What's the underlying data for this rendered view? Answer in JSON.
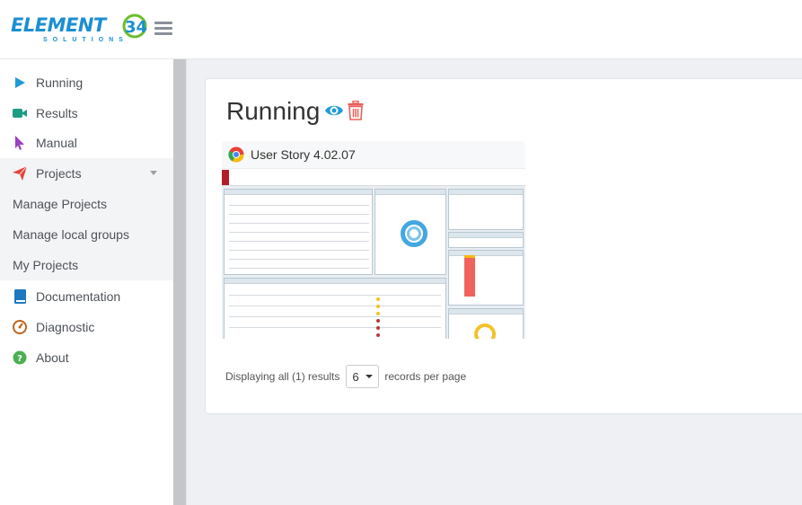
{
  "brand": {
    "logo_text": "ELEMENT 34",
    "logo_sub": "SOLUTIONS"
  },
  "sidebar": {
    "items": [
      {
        "label": "Running",
        "icon": "play-icon",
        "color": "#1f9ad6"
      },
      {
        "label": "Results",
        "icon": "video-camera-icon",
        "color": "#1e9c83"
      },
      {
        "label": "Manual",
        "icon": "pointer-icon",
        "color": "#9b3fbf"
      },
      {
        "label": "Projects",
        "icon": "paper-plane-icon",
        "color": "#e0463d"
      },
      {
        "label": "Manage Projects"
      },
      {
        "label": "Manage local groups"
      },
      {
        "label": "My Projects"
      },
      {
        "label": "Documentation",
        "icon": "book-icon",
        "color": "#1e78c0"
      },
      {
        "label": "Diagnostic",
        "icon": "gauge-icon",
        "color": "#c0651d"
      },
      {
        "label": "About",
        "icon": "question-circle-icon",
        "color": "#4caf50"
      }
    ]
  },
  "main": {
    "title": "Running",
    "story": {
      "title": "User Story 4.02.07"
    },
    "pager": {
      "prefix": "Displaying all (1) results",
      "per_page": "6",
      "suffix": "records per page"
    }
  },
  "colors": {
    "accent": "#1f9ad6",
    "danger": "#e8605a",
    "background": "#eef0f3"
  }
}
